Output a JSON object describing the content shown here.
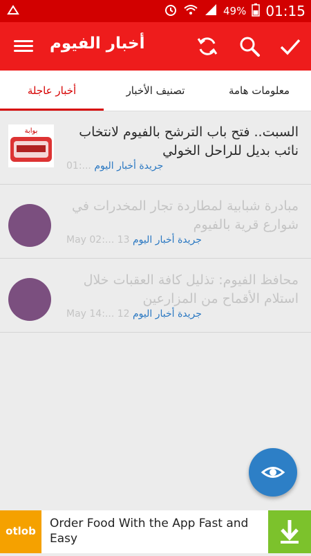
{
  "status": {
    "battery": "49%",
    "time": "01:15",
    "icons": [
      "sd-card-icon",
      "alarm-icon",
      "wifi-icon",
      "signal-icon",
      "battery-icon"
    ]
  },
  "appbar": {
    "title": "أخبار الفيوم",
    "icons": [
      "menu-icon",
      "refresh-icon",
      "search-icon",
      "check-icon"
    ]
  },
  "tabs": [
    {
      "label": "أخبار عاجلة",
      "active": true
    },
    {
      "label": "تصنيف الأخبار",
      "active": false
    },
    {
      "label": "معلومات هامة",
      "active": false
    }
  ],
  "news": [
    {
      "headline": "السبت.. فتح باب الترشح بالفيوم لانتخاب نائب بديل للراحل الخولي",
      "source": "جريدة أخبار اليوم",
      "date": "01:...",
      "read": false,
      "logo_text": "بوابة"
    },
    {
      "headline": "مبادرة شبابية لمطاردة تجار المخدرات في شوارع قرية بالفيوم",
      "source": "جريدة أخبار اليوم",
      "date": "May 02:... 13",
      "read": true
    },
    {
      "headline": "محافظ الفيوم: تذليل كافة العقبات خلال استلام الأقماح من المزارعين",
      "source": "جريدة أخبار اليوم",
      "date": "May 14:... 12",
      "read": true
    }
  ],
  "fab": {
    "icon": "eye-icon"
  },
  "ad": {
    "brand": "otlob",
    "text": "Order Food With the App Fast and Easy",
    "icon": "download-icon",
    "colors": {
      "brand": "#f5a100",
      "download": "#7cc22c"
    }
  },
  "colors": {
    "accent": "#ee1c1c",
    "status_bar": "#d20000",
    "link": "#2a78c2",
    "fab": "#2d7fc6"
  }
}
